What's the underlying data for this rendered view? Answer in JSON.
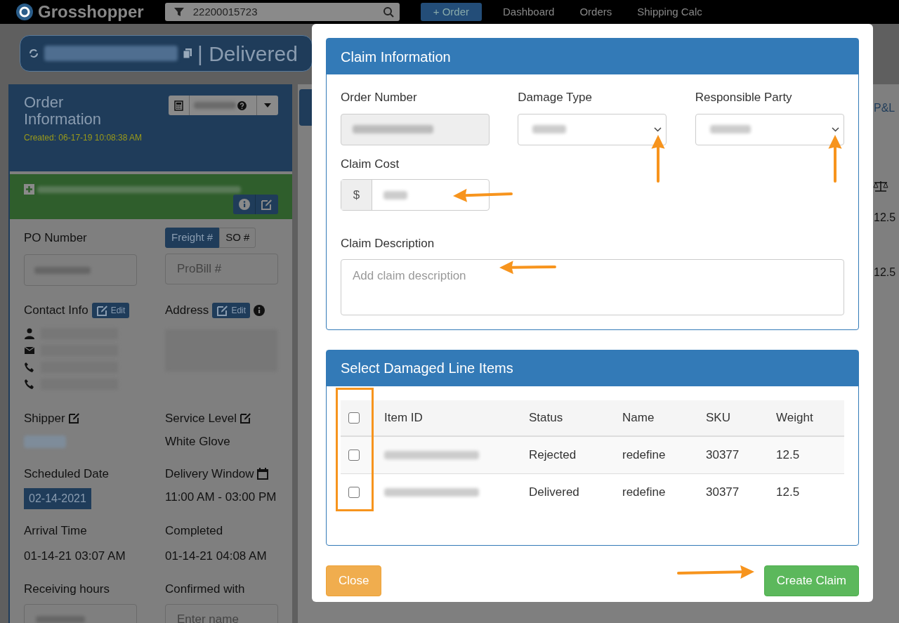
{
  "navbar": {
    "brand": "Grosshopper",
    "search_value": "22200015723",
    "order_button": "+ Order",
    "links": [
      "Dashboard",
      "Orders",
      "Shipping Calc"
    ]
  },
  "order_header": {
    "status": "| Delivered"
  },
  "order_panel": {
    "title": "Order Information",
    "created": "Created: 06-17-19 10:08:38 AM",
    "po_label": "PO Number",
    "number_toggle": [
      {
        "label": "Freight #",
        "selected": true
      },
      {
        "label": "SO #",
        "selected": false
      }
    ],
    "probill_placeholder": "ProBill #",
    "contact_label": "Contact Info",
    "contact_edit": "Edit",
    "address_label": "Address",
    "address_edit": "Edit",
    "shipper_label": "Shipper",
    "service_label": "Service Level",
    "service_value": "White Glove",
    "scheduled_label": "Scheduled Date",
    "scheduled_value": "02-14-2021",
    "window_label": "Delivery Window",
    "window_value": "11:00 AM - 03:00 PM",
    "arrival_label": "Arrival Time",
    "arrival_value": "01-14-21 03:07 AM",
    "completed_label": "Completed",
    "completed_value": "01-14-21 04:08 AM",
    "receiving_label": "Receiving hours",
    "confirmed_label": "Confirmed with",
    "confirmed_placeholder": "Enter name"
  },
  "background_table": {
    "pl_link": "P&L",
    "weights": [
      "12.5",
      "12.5"
    ]
  },
  "modal": {
    "claim_info": {
      "title": "Claim Information",
      "order_number_label": "Order Number",
      "damage_type_label": "Damage Type",
      "responsible_label": "Responsible Party",
      "cost_label": "Claim Cost",
      "currency": "$",
      "description_label": "Claim Description",
      "description_placeholder": "Add claim description"
    },
    "line_items": {
      "title": "Select Damaged Line Items",
      "select_all_checked": false,
      "columns": [
        "Item ID",
        "Status",
        "Name",
        "SKU",
        "Weight"
      ],
      "rows": [
        {
          "checked": false,
          "status": "Rejected",
          "name": "redefine",
          "sku": "30377",
          "weight": "12.5"
        },
        {
          "checked": false,
          "status": "Delivered",
          "name": "redefine",
          "sku": "30377",
          "weight": "12.5"
        }
      ]
    },
    "buttons": {
      "close": "Close",
      "create": "Create Claim"
    }
  }
}
